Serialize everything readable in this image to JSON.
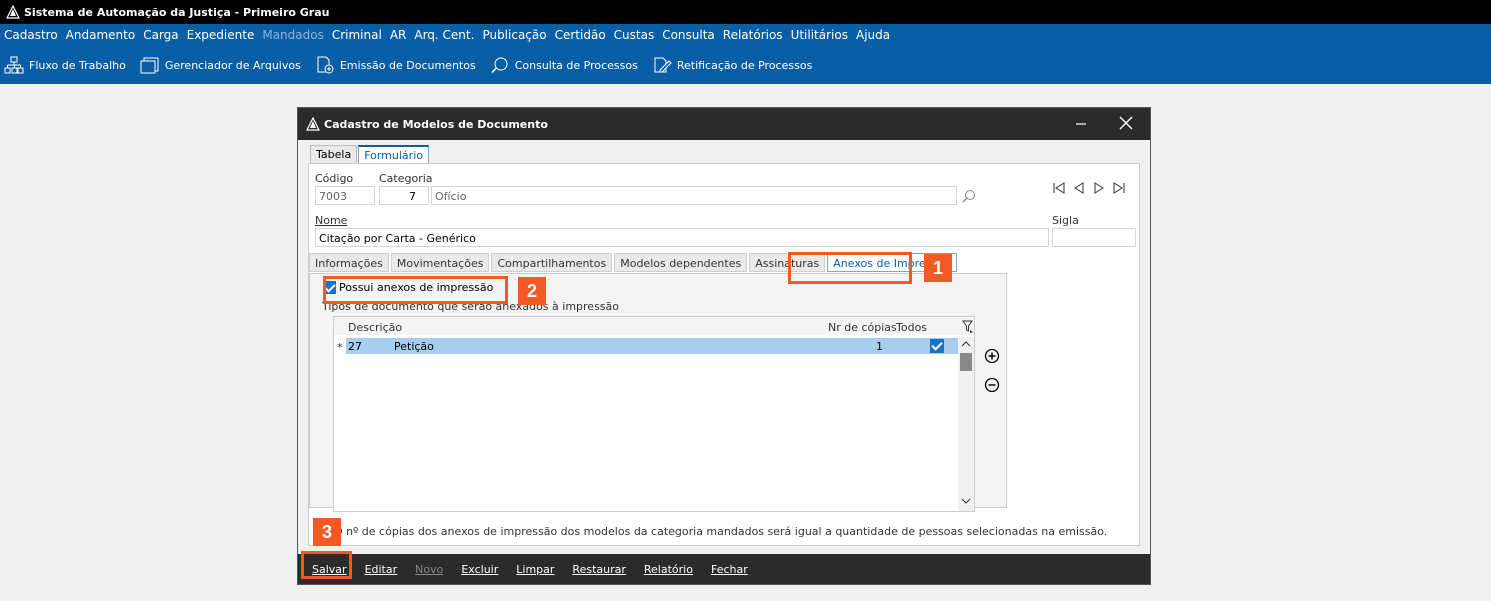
{
  "app": {
    "title": "Sistema de Automação da Justiça - Primeiro Grau"
  },
  "menu": [
    "Cadastro",
    "Andamento",
    "Carga",
    "Expediente",
    "Mandados",
    "Criminal",
    "AR",
    "Arq. Cent.",
    "Publicação",
    "Certidão",
    "Custas",
    "Consulta",
    "Relatórios",
    "Utilitários",
    "Ajuda"
  ],
  "menu_disabled": "Mandados",
  "toolbar": {
    "fluxo": "Fluxo de Trabalho",
    "arquivos": "Gerenciador de Arquivos",
    "emissao": "Emissão de Documentos",
    "consulta": "Consulta de Processos",
    "retificacao": "Retificação de Processos"
  },
  "dialog": {
    "title": "Cadastro de Modelos de Documento",
    "tabs": {
      "tabela": "Tabela",
      "formulario": "Formulário"
    },
    "codigo_label": "Código",
    "codigo_value": "7003",
    "categoria_label": "Categoria",
    "categoria_num": "7",
    "categoria_value": "Ofício",
    "nome_label": "Nome",
    "nome_value": "Citação por Carta - Genérico",
    "sigla_label": "Sigla",
    "sigla_value": "",
    "subtabs": {
      "informacoes": "Informações",
      "movimentacoes": "Movimentações",
      "compartilhamentos": "Compartilhamentos",
      "modelos": "Modelos dependentes",
      "assinaturas": "Assinaturas",
      "anexos": "Anexos de Impressão"
    },
    "checkbox_label": "Possui anexos de impressão",
    "hint": "Tipos de documento que serão anexados à impressão",
    "grid": {
      "col_descricao": "Descrição",
      "col_copias": "Nr de cópias",
      "col_todos": "Todos",
      "row": {
        "indicator": "*",
        "codigo": "27",
        "descricao": "Petição",
        "copias": "1"
      }
    },
    "note": "O nº de cópias dos anexos de impressão dos modelos da categoria mandados será igual a quantidade de pessoas selecionadas na emissão.",
    "buttons": {
      "salvar": "Salvar",
      "editar": "Editar",
      "novo": "Novo",
      "excluir": "Excluir",
      "limpar": "Limpar",
      "restaurar": "Restaurar",
      "relatorio": "Relatório",
      "fechar": "Fechar"
    }
  },
  "callouts": {
    "one": "1",
    "two": "2",
    "three": "3"
  },
  "colors": {
    "accent": "#0a5ea6",
    "callout": "#f15a24",
    "selection": "#a7cdf0"
  }
}
